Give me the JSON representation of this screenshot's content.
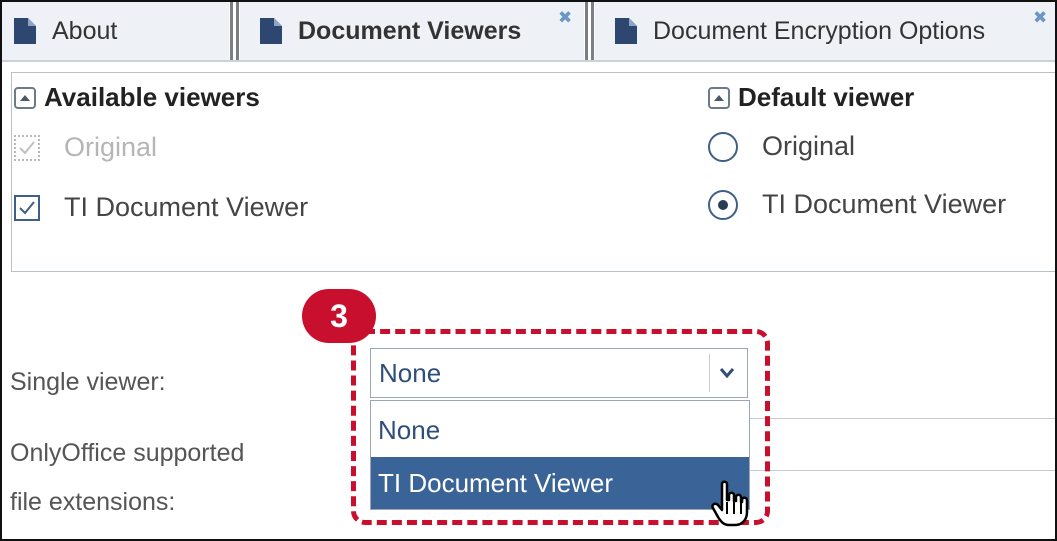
{
  "tabs": [
    {
      "label": "About",
      "active": false,
      "closable": false
    },
    {
      "label": "Document Viewers",
      "active": true,
      "closable": true
    },
    {
      "label": "Document Encryption Options",
      "active": false,
      "closable": true
    }
  ],
  "available_viewers": {
    "title": "Available viewers",
    "options": [
      {
        "label": "Original",
        "checked": true,
        "disabled": true
      },
      {
        "label": "TI Document Viewer",
        "checked": true,
        "disabled": false
      }
    ]
  },
  "default_viewer": {
    "title": "Default viewer",
    "options": [
      {
        "label": "Original",
        "selected": false
      },
      {
        "label": "TI Document Viewer",
        "selected": true
      }
    ]
  },
  "single_viewer": {
    "label": "Single viewer:",
    "value": "None",
    "options": [
      "None",
      "TI Document Viewer"
    ],
    "highlighted": "TI Document Viewer"
  },
  "onlyoffice": {
    "label_line1": "OnlyOffice supported",
    "label_line2": "file extensions:"
  },
  "callout": {
    "step": "3"
  },
  "colors": {
    "accent": "#3a6497",
    "callout": "#c8102e",
    "close_icon": "#6a97c8"
  }
}
